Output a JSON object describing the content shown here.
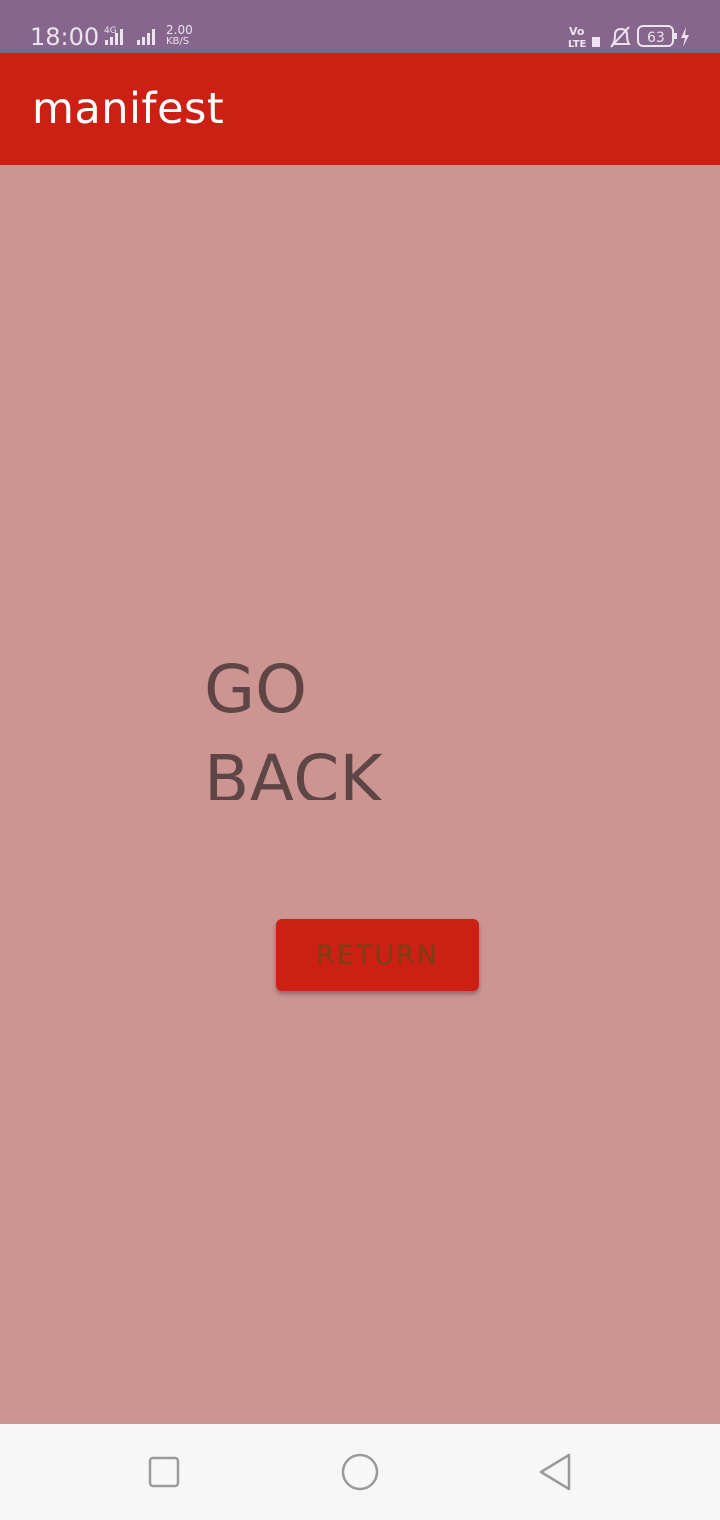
{
  "status_bar": {
    "time": "18:00",
    "network": "4G",
    "speed_value": "2.00",
    "speed_unit": "KB/S",
    "volte": "Vo LTE",
    "battery": "63"
  },
  "app_bar": {
    "title": "manifest"
  },
  "main": {
    "heading": "GO BACK",
    "return_button_label": "RETURN"
  },
  "nav_bar": {
    "recent_icon": "square-icon",
    "home_icon": "circle-icon",
    "back_icon": "triangle-back-icon"
  },
  "colors": {
    "status_bar": "#86668c",
    "app_bar": "#cd2014",
    "background": "#cc9592",
    "button": "#cd2014",
    "heading_text": "#5e4646",
    "button_text": "#7a3f12",
    "nav_bar": "#f7f7f7"
  }
}
